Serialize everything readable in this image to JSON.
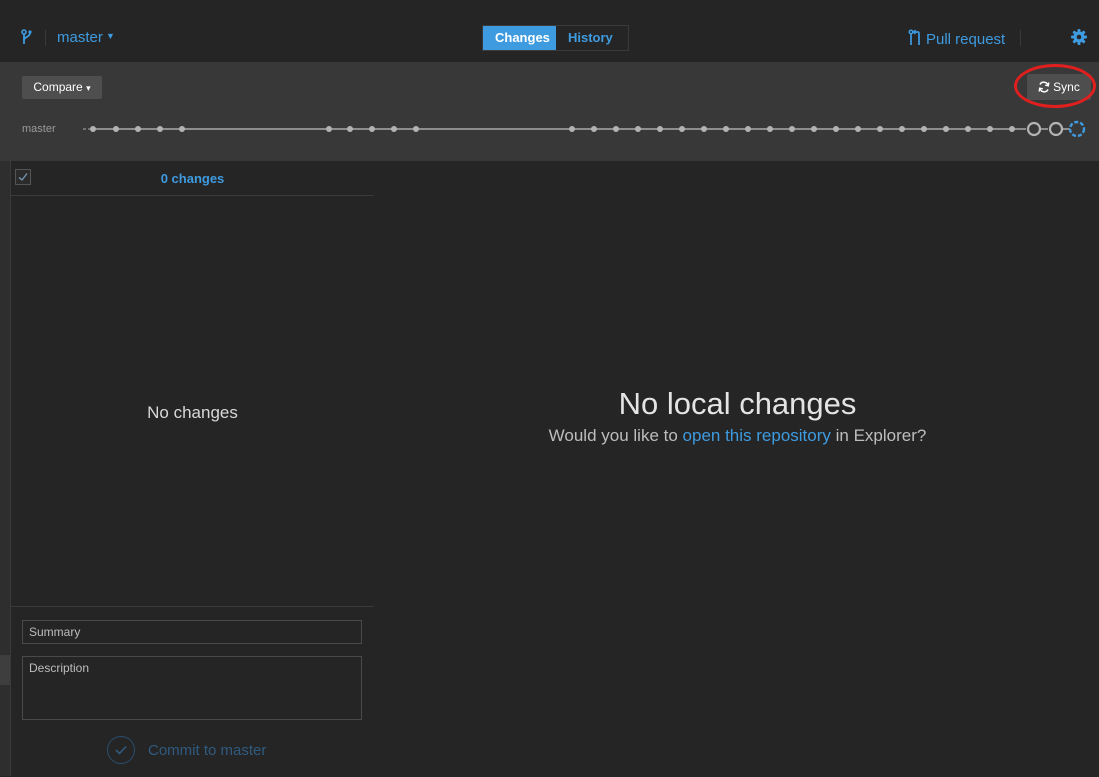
{
  "window": {
    "minimize_glyph": "▬",
    "maximize_glyph": "□",
    "close_glyph": "✕"
  },
  "header": {
    "branch_icon": "git-branch-icon",
    "branch_name": "master",
    "branch_caret": "▼",
    "tabs": [
      {
        "label": "Changes",
        "active": true
      },
      {
        "label": "History",
        "active": false
      }
    ],
    "pull_request_label": "Pull request",
    "pull_request_icon": "git-pull-request-icon",
    "settings_icon": "gear-icon"
  },
  "toolbar": {
    "compare_label": "Compare",
    "compare_caret": "▾",
    "sync_label": "Sync",
    "sync_icon": "refresh-icon",
    "timeline_branch_label": "master"
  },
  "changes_panel": {
    "count_label": "0 changes",
    "empty_text": "No changes",
    "summary_placeholder": "Summary",
    "description_placeholder": "Description",
    "commit_label": "Commit to master"
  },
  "main": {
    "empty_title": "No local changes",
    "empty_sub_prefix": "Would you like to ",
    "empty_sub_link": "open this repository",
    "empty_sub_suffix": " in Explorer?"
  },
  "colors": {
    "accent": "#3e9be0",
    "background": "#252525",
    "band": "#383838",
    "highlight": "#e01f1f"
  }
}
